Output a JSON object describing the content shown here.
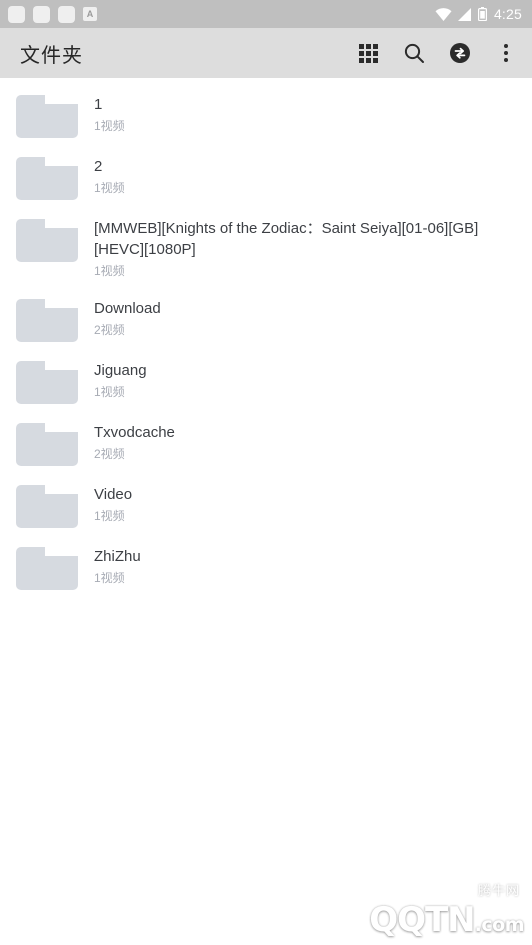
{
  "statusbar": {
    "notification_icons": [
      "app-notification",
      "app-notification",
      "app-notification",
      "letter-a-notification"
    ],
    "letter_a": "A",
    "wifi_icon": "wifi-icon",
    "signal_icon": "signal-icon",
    "battery_icon": "battery-icon",
    "time": "4:25",
    "background_color": "#bfbfbf"
  },
  "toolbar": {
    "title": "文件夹",
    "background_color": "#dddddd",
    "actions": [
      {
        "name": "grid-view-icon",
        "label": ""
      },
      {
        "name": "search-icon",
        "label": ""
      },
      {
        "name": "transfer-icon",
        "label": ""
      },
      {
        "name": "overflow-menu-icon",
        "label": ""
      }
    ]
  },
  "list": {
    "icon_name": "folder-icon",
    "folder_color": "#d6dae0",
    "items": [
      {
        "title": "1",
        "subtitle": "1视频"
      },
      {
        "title": "2",
        "subtitle": "1视频"
      },
      {
        "title": "[MMWEB][Knights of the Zodiac：Saint Seiya][01-06][GB][HEVC][1080P]",
        "subtitle": "1视频"
      },
      {
        "title": "Download",
        "subtitle": "2视频"
      },
      {
        "title": "Jiguang",
        "subtitle": "1视频"
      },
      {
        "title": "Txvodcache",
        "subtitle": "2视频"
      },
      {
        "title": "Video",
        "subtitle": "1视频"
      },
      {
        "title": "ZhiZhu",
        "subtitle": "1视频"
      }
    ]
  },
  "watermark": {
    "logo_name": "qqtn-logo-icon",
    "main": "QQTN",
    "dotcom": ".com",
    "badge": "腾牛网"
  }
}
